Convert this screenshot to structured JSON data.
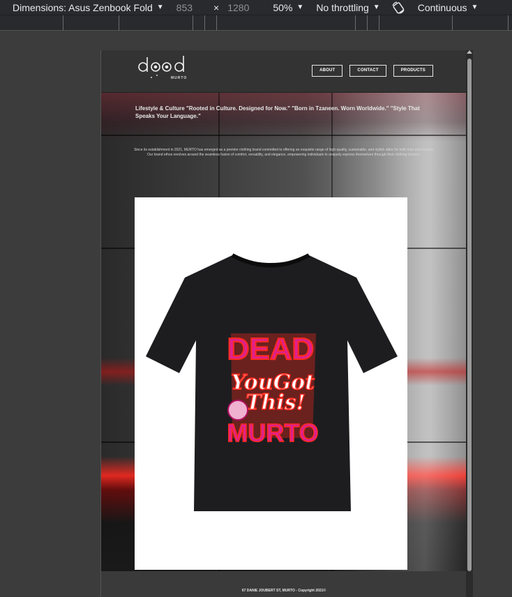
{
  "devtools": {
    "dimensions_label": "Dimensions: Asus Zenbook Fold",
    "width": "853",
    "separator": "×",
    "height": "1280",
    "zoom": "50%",
    "throttling": "No throttling",
    "mode": "Continuous",
    "icons": {
      "dropdown": "caret-down-icon",
      "rotate": "rotate-icon"
    }
  },
  "site": {
    "logo_script": "dood",
    "logo_sub": "MURTO",
    "nav": [
      "ABOUT",
      "CONTACT",
      "PRODUCTS"
    ],
    "tagline": "Lifestyle & Culture \"Rooted in Culture. Designed for Now.\" \"Born in Tzaneen. Worn Worldwide.\" \"Style That Speaks Your Language.\"",
    "about": "Since its establishment in 2021, MURTO has emerged as a premier clothing brand committed to offering an exquisite range of high-quality, sustainable, and stylish attire for both men and women. Our brand ethos revolves around the seamless fusion of comfort, versatility, and elegance, empowering individuals to uniquely express themselves through their clothing choices.",
    "product_print": {
      "top": "DEAD",
      "middle1": "YouGot",
      "middle2": "This!",
      "bottom": "MURTO"
    },
    "footer": "67 DANIE JOUBERT ST, MURTO - Copyright 2021©"
  },
  "colors": {
    "toolbar_bg": "#292a2d",
    "workspace_bg": "#3c3c3c",
    "header_bg": "#333333",
    "accent_pink": "#e0208a",
    "accent_red": "#ff2a1e"
  }
}
